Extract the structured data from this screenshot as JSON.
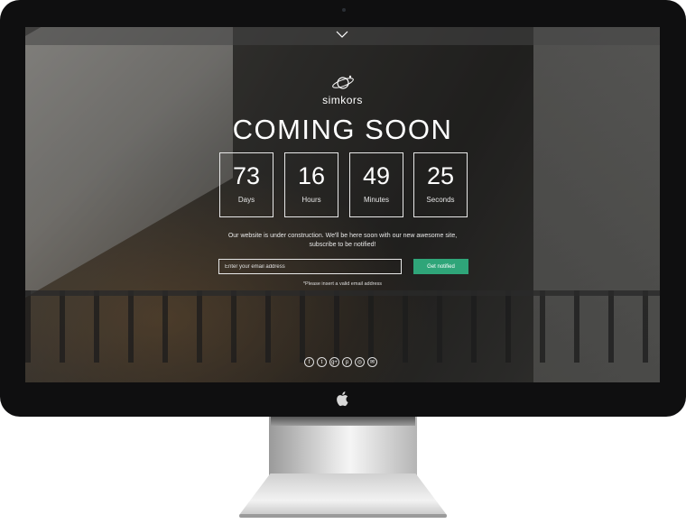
{
  "brand": {
    "name": "simkors"
  },
  "title": "COMING SOON",
  "countdown": [
    {
      "value": "73",
      "label": "Days"
    },
    {
      "value": "16",
      "label": "Hours"
    },
    {
      "value": "49",
      "label": "Minutes"
    },
    {
      "value": "25",
      "label": "Seconds"
    }
  ],
  "message": {
    "line1": "Our website is under construction. We'll be here soon with our new awesome site,",
    "line2": "subscribe to be notified!"
  },
  "subscribe": {
    "placeholder": "Enter your email address",
    "button_label": "Get notified",
    "hint": "*Please insert a valid email address"
  },
  "social": [
    {
      "icon": "facebook-icon",
      "glyph": "f"
    },
    {
      "icon": "twitter-icon",
      "glyph": "t"
    },
    {
      "icon": "google-plus-icon",
      "glyph": "g+"
    },
    {
      "icon": "pinterest-icon",
      "glyph": "p"
    },
    {
      "icon": "instagram-icon",
      "glyph": "◎"
    },
    {
      "icon": "email-icon",
      "glyph": "✉"
    }
  ],
  "colors": {
    "accent": "#2fa579",
    "bezel": "#0f0f10",
    "text": "#ffffff"
  }
}
